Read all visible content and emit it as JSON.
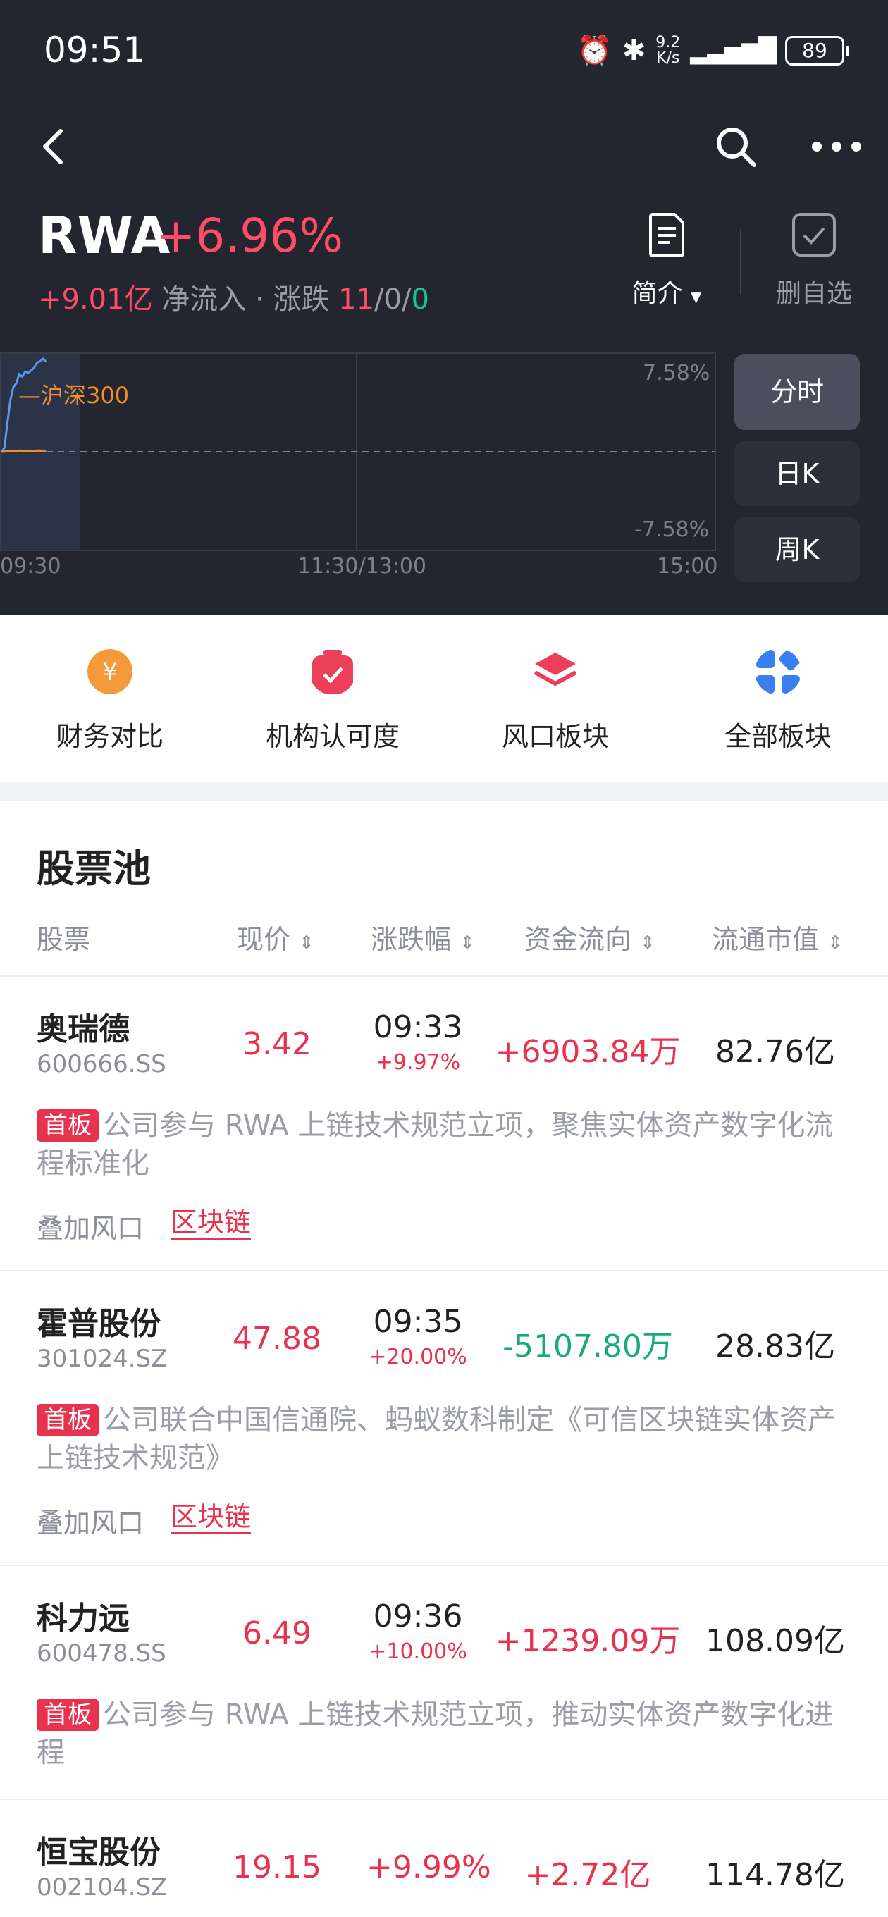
{
  "status": {
    "time": "09:51",
    "net_speed_top": "9.2",
    "net_speed_bottom": "K/s",
    "battery": "89"
  },
  "header": {
    "title": "RWA",
    "change_pct": "+6.96%",
    "net_inflow": "+9.01亿",
    "net_inflow_label": "净流入",
    "separator": " · ",
    "updown_label": "涨跌",
    "up_count": "11",
    "slash1": "/",
    "flat_count": "0",
    "slash2": "/",
    "down_count": "0",
    "intro_label": "简介",
    "watchlist_label": "删自选"
  },
  "chart_data": {
    "type": "line",
    "title": "",
    "x_ticks": [
      "09:30",
      "11:30/13:00",
      "15:00"
    ],
    "y_ticks": [
      "7.58%",
      "-7.58%"
    ],
    "ylim": [
      -7.58,
      7.58
    ],
    "series": [
      {
        "name": "",
        "color": "#5b9ae8",
        "x": [
          "09:30",
          "09:31",
          "09:32",
          "09:33",
          "09:34",
          "09:35",
          "09:36",
          "09:37",
          "09:38",
          "09:39",
          "09:40",
          "09:41",
          "09:42",
          "09:43",
          "09:44",
          "09:45"
        ],
        "values": [
          0.0,
          0.3,
          2.2,
          4.0,
          5.0,
          5.3,
          6.0,
          5.8,
          6.2,
          6.1,
          6.3,
          6.5,
          6.9,
          7.0,
          7.2,
          6.96
        ]
      },
      {
        "name": "沪深300",
        "color": "#f0902b",
        "x": [
          "09:30",
          "09:33",
          "09:36",
          "09:39",
          "09:42",
          "09:45"
        ],
        "values": [
          0.0,
          0.05,
          0.1,
          0.05,
          0.1,
          0.08
        ]
      }
    ],
    "baseline": 0
  },
  "periods": [
    "分时",
    "日K",
    "周K"
  ],
  "features": [
    {
      "label": "财务对比",
      "icon": "yuan-coin-icon",
      "color": "#f59a3a"
    },
    {
      "label": "机构认可度",
      "icon": "check-bag-icon",
      "color": "#ec3f5c"
    },
    {
      "label": "风口板块",
      "icon": "layers-icon",
      "color": "#ec3f5c"
    },
    {
      "label": "全部板块",
      "icon": "grid-icon",
      "color": "#3a7ff0"
    }
  ],
  "pool": {
    "title": "股票池",
    "columns": [
      "股票",
      "现价",
      "涨跌幅",
      "资金流向",
      "流通市值"
    ],
    "overlay_label": "叠加风口",
    "rows": [
      {
        "name": "奥瑞德",
        "code": "600666.SS",
        "price": "3.42",
        "time": "09:33",
        "pct": "+9.97%",
        "flow": "+6903.84万",
        "flow_dir": "up",
        "cap": "82.76亿",
        "badge": "首板",
        "desc": "公司参与 RWA 上链技术规范立项，聚焦实体资产数字化流程标准化",
        "tag": "区块链"
      },
      {
        "name": "霍普股份",
        "code": "301024.SZ",
        "price": "47.88",
        "time": "09:35",
        "pct": "+20.00%",
        "flow": "-5107.80万",
        "flow_dir": "down",
        "cap": "28.83亿",
        "badge": "首板",
        "desc": "公司联合中国信通院、蚂蚁数科制定《可信区块链实体资产上链技术规范》",
        "tag": "区块链"
      },
      {
        "name": "科力远",
        "code": "600478.SS",
        "price": "6.49",
        "time": "09:36",
        "pct": "+10.00%",
        "flow": "+1239.09万",
        "flow_dir": "up",
        "cap": "108.09亿",
        "badge": "首板",
        "desc": "公司参与 RWA 上链技术规范立项，推动实体资产数字化进程"
      },
      {
        "name": "恒宝股份",
        "code": "002104.SZ",
        "price": "19.15",
        "pct_main": "+9.99%",
        "flow": "+2.72亿",
        "flow_dir": "up",
        "cap": "114.78亿"
      }
    ]
  }
}
